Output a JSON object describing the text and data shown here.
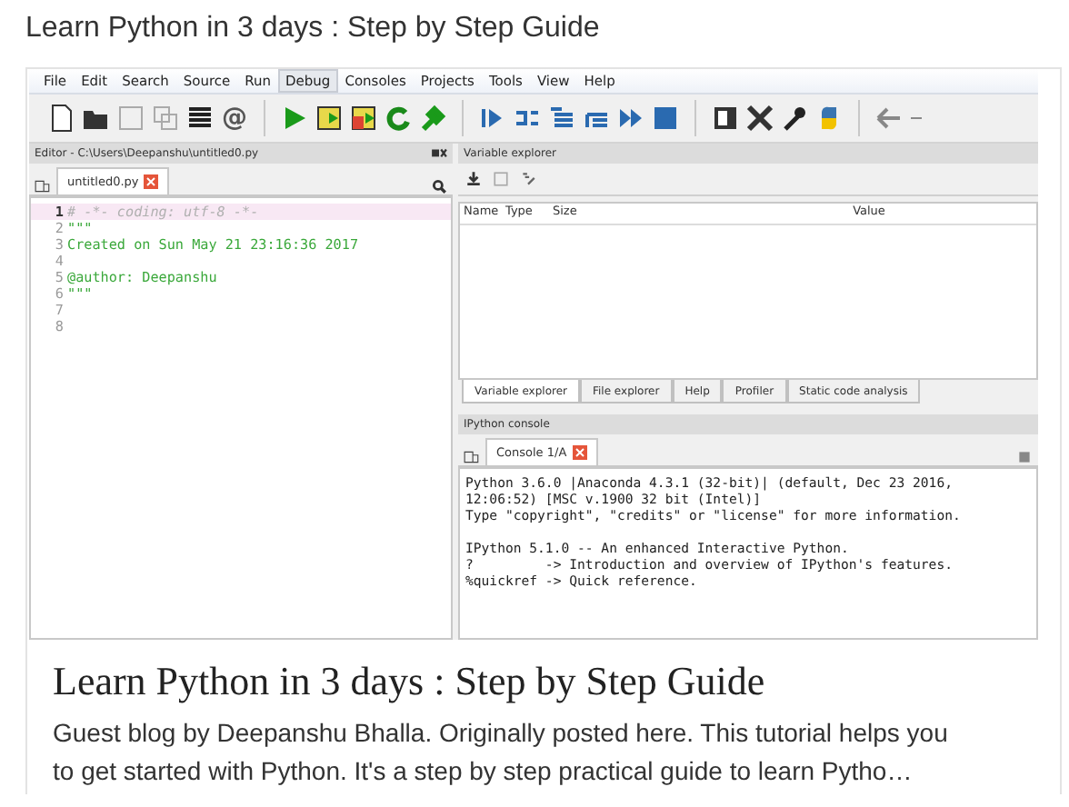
{
  "page_title": "Learn Python in 3 days : Step by Step Guide",
  "card": {
    "preview": {
      "menu": [
        {
          "label": "File",
          "selected": false
        },
        {
          "label": "Edit",
          "selected": false
        },
        {
          "label": "Search",
          "selected": false
        },
        {
          "label": "Source",
          "selected": false
        },
        {
          "label": "Run",
          "selected": false
        },
        {
          "label": "Debug",
          "selected": true
        },
        {
          "label": "Consoles",
          "selected": false
        },
        {
          "label": "Projects",
          "selected": false
        },
        {
          "label": "Tools",
          "selected": false
        },
        {
          "label": "View",
          "selected": false
        },
        {
          "label": "Help",
          "selected": false
        }
      ],
      "toolbar_glyph": "@",
      "editor": {
        "title": "Editor - C:\\Users\\Deepanshu\\untitled0.py",
        "tabs": [
          {
            "label": "untitled0.py",
            "selected": true
          }
        ],
        "lines": [
          {
            "number": "1",
            "text": "# -*- coding: utf-8 -*-",
            "kind": "comment",
            "current": true
          },
          {
            "number": "2",
            "text": "\"\"\"",
            "kind": "string",
            "current": false
          },
          {
            "number": "3",
            "text": "Created on Sun May 21 23:16:36 2017",
            "kind": "string",
            "current": false
          },
          {
            "number": "4",
            "current": false
          },
          {
            "number": "5",
            "text": "@author: Deepanshu",
            "kind": "string",
            "current": false
          },
          {
            "number": "6",
            "text": "\"\"\"",
            "kind": "string",
            "current": false
          },
          {
            "number": "7",
            "current": false
          },
          {
            "number": "8",
            "current": false
          }
        ]
      },
      "variable_explorer": {
        "title": "Variable explorer",
        "columns": [
          "Name",
          "Type",
          "Size",
          "Value"
        ],
        "tabs": [
          {
            "label": "Variable explorer",
            "selected": true
          },
          {
            "label": "File explorer",
            "selected": false
          },
          {
            "label": "Help",
            "selected": false
          },
          {
            "label": "Profiler",
            "selected": false
          },
          {
            "label": "Static code analysis",
            "selected": false
          }
        ]
      },
      "console": {
        "title": "IPython console",
        "tabs": [
          {
            "label": "Console 1/A",
            "selected": true
          }
        ],
        "blocks": [
          [
            "Python 3.6.0 |Anaconda 4.3.1 (32-bit)| (default, Dec 23 2016,",
            "12:06:52) [MSC v.1900 32 bit (Intel)]",
            "Type \"copyright\", \"credits\" or \"license\" for more information."
          ],
          [
            "IPython 5.1.0 -- An enhanced Interactive Python.",
            "?         -> Introduction and overview of IPython's features.",
            "%quickref -> Quick reference."
          ]
        ]
      }
    },
    "title": "Learn Python in 3 days : Step by Step Guide",
    "description": "Guest blog by Deepanshu Bhalla. Originally posted here. This tutorial helps you to get started with Python. It's a step by step practical guide to learn Pytho…"
  }
}
